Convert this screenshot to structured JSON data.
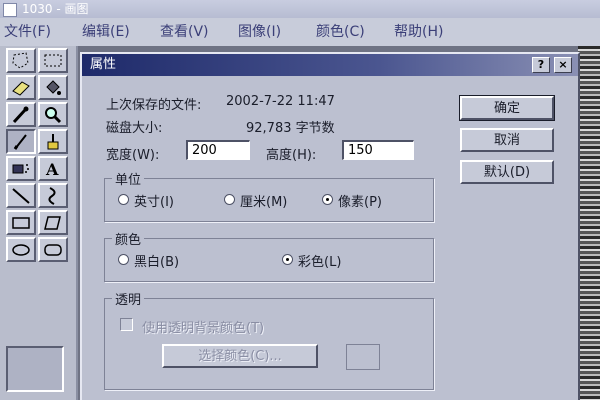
{
  "window": {
    "title": "1030 - 画图"
  },
  "menu": [
    {
      "label": "文件(F)"
    },
    {
      "label": "编辑(E)"
    },
    {
      "label": "查看(V)"
    },
    {
      "label": "图像(I)"
    },
    {
      "label": "颜色(C)"
    },
    {
      "label": "帮助(H)"
    }
  ],
  "tools": [
    "free-select-icon",
    "rect-select-icon",
    "eraser-icon",
    "fill-bucket-icon",
    "eyedropper-icon",
    "magnifier-icon",
    "pencil-icon",
    "brush-icon",
    "airbrush-icon",
    "text-icon",
    "line-icon",
    "curve-icon",
    "rectangle-icon",
    "polygon-icon",
    "ellipse-icon",
    "rounded-rect-icon"
  ],
  "dialog": {
    "title": "属性",
    "help_btn": "?",
    "close_btn": "×",
    "last_saved_label": "上次保存的文件:",
    "last_saved_value": "2002-7-22  11:47",
    "disk_size_label": "磁盘大小:",
    "disk_size_value": "92,783 字节数",
    "width_label": "宽度(W):",
    "width_value": "200",
    "height_label": "高度(H):",
    "height_value": "150",
    "units": {
      "group_label": "单位",
      "options": [
        "英寸(I)",
        "厘米(M)",
        "像素(P)"
      ],
      "selected": "像素(P)"
    },
    "colors": {
      "group_label": "颜色",
      "options": [
        "黑白(B)",
        "彩色(L)"
      ],
      "selected": "彩色(L)"
    },
    "transparency": {
      "group_label": "透明",
      "checkbox_label": "使用透明背景颜色(T)",
      "select_color_btn": "选择颜色(C)..."
    },
    "ok_btn": "确定",
    "cancel_btn": "取消",
    "default_btn": "默认(D)"
  }
}
